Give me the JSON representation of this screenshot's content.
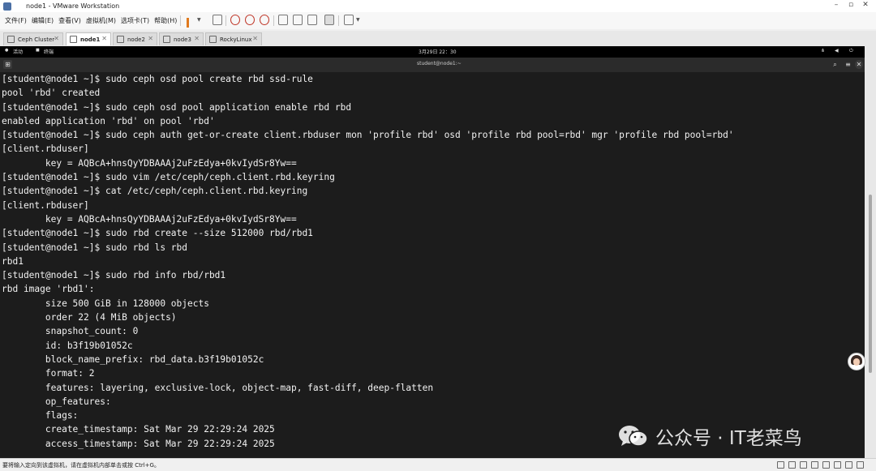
{
  "window": {
    "title": "node1 - VMware Workstation"
  },
  "menu": {
    "items": [
      "文件(F)",
      "编辑(E)",
      "查看(V)",
      "虚拟机(M)",
      "选项卡(T)",
      "帮助(H)"
    ]
  },
  "tabs": [
    {
      "label": "Ceph Cluster",
      "active": false
    },
    {
      "label": "node1",
      "active": true
    },
    {
      "label": "node2",
      "active": false
    },
    {
      "label": "node3",
      "active": false
    },
    {
      "label": "RockyLinux",
      "active": false
    }
  ],
  "gnome": {
    "activities": "活动",
    "app": "终端",
    "clock": "3月29日 22：30"
  },
  "terminal": {
    "title": "student@node1:~",
    "lines": [
      "[student@node1 ~]$ sudo ceph osd pool create rbd ssd-rule",
      "pool 'rbd' created",
      "[student@node1 ~]$ sudo ceph osd pool application enable rbd rbd",
      "enabled application 'rbd' on pool 'rbd'",
      "[student@node1 ~]$ sudo ceph auth get-or-create client.rbduser mon 'profile rbd' osd 'profile rbd pool=rbd' mgr 'profile rbd pool=rbd'",
      "[client.rbduser]",
      "        key = AQBcA+hnsQyYDBAAAj2uFzEdya+0kvIydSr8Yw==",
      "[student@node1 ~]$ sudo vim /etc/ceph/ceph.client.rbd.keyring",
      "[student@node1 ~]$ cat /etc/ceph/ceph.client.rbd.keyring",
      "[client.rbduser]",
      "        key = AQBcA+hnsQyYDBAAAj2uFzEdya+0kvIydSr8Yw==",
      "[student@node1 ~]$ sudo rbd create --size 512000 rbd/rbd1",
      "[student@node1 ~]$ sudo rbd ls rbd",
      "rbd1",
      "[student@node1 ~]$ sudo rbd info rbd/rbd1",
      "rbd image 'rbd1':",
      "        size 500 GiB in 128000 objects",
      "        order 22 (4 MiB objects)",
      "        snapshot_count: 0",
      "        id: b3f19b01052c",
      "        block_name_prefix: rbd_data.b3f19b01052c",
      "        format: 2",
      "        features: layering, exclusive-lock, object-map, fast-diff, deep-flatten",
      "        op_features:",
      "        flags:",
      "        create_timestamp: Sat Mar 29 22:29:24 2025",
      "        access_timestamp: Sat Mar 29 22:29:24 2025"
    ]
  },
  "watermark": {
    "text": "公众号 · IT老菜鸟"
  },
  "statusbar": {
    "text": "要将输入定向到该虚拟机，请在虚拟机内部单击或按 Ctrl+G。"
  }
}
